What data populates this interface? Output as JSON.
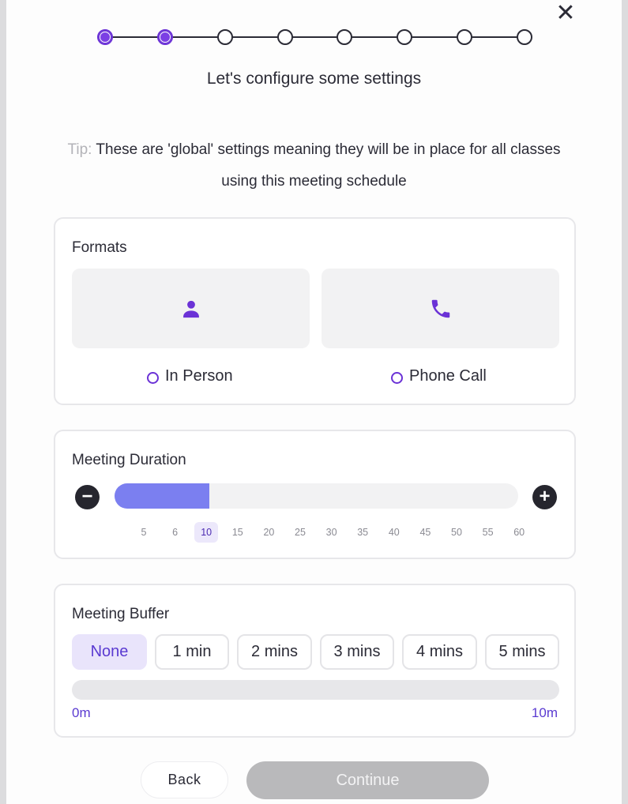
{
  "dialog": {
    "close_glyph": "✕",
    "title": "Let's configure some settings",
    "tip_label": "Tip:",
    "tip_text": "These are 'global' settings meaning they will be in place for all classes using this meeting schedule"
  },
  "stepper": {
    "total_steps": 8,
    "completed_steps": 2
  },
  "formats": {
    "title": "Formats",
    "options": [
      {
        "label": "In Person",
        "icon": "person-icon",
        "selected": false
      },
      {
        "label": "Phone Call",
        "icon": "phone-icon",
        "selected": false
      }
    ]
  },
  "duration": {
    "title": "Meeting Duration",
    "decrease_glyph": "−",
    "increase_glyph": "+",
    "ticks": [
      "5",
      "6",
      "10",
      "15",
      "20",
      "25",
      "30",
      "35",
      "40",
      "45",
      "50",
      "55",
      "60"
    ],
    "selected": "10"
  },
  "buffer": {
    "title": "Meeting Buffer",
    "options": [
      "None",
      "1 min",
      "2 mins",
      "3 mins",
      "4 mins",
      "5 mins"
    ],
    "selected": "None",
    "range_min_label": "0m",
    "range_max_label": "10m"
  },
  "footer": {
    "back_label": "Back",
    "continue_label": "Continue"
  },
  "colors": {
    "accent": "#6b32d6",
    "slider_fill": "#7b7ff0",
    "continue_disabled": "#b9b9bb"
  }
}
